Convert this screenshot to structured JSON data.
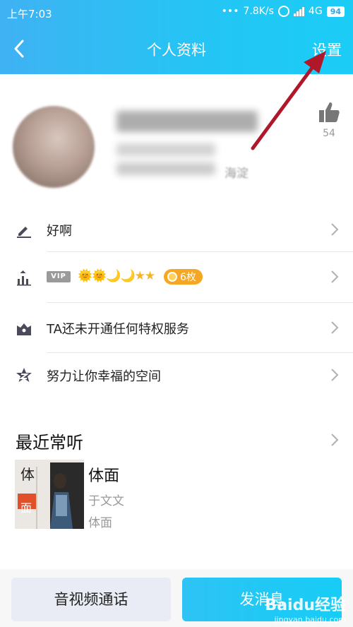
{
  "statusbar": {
    "time": "上午7:03",
    "network_speed": "7.8K/s",
    "network_type": "4G",
    "battery": "94"
  },
  "navbar": {
    "title": "个人资料",
    "settings_label": "设置"
  },
  "profile": {
    "city": "海淀",
    "like_count": "54"
  },
  "rows": [
    {
      "label": "好啊",
      "icon": "pencil-icon"
    },
    {
      "label": "VIP",
      "icon": "level-up-icon",
      "level_icons": "🌞🌞🌙🌙★★",
      "badge": "6枚"
    },
    {
      "label": "TA还未开通任何特权服务",
      "icon": "crown-icon"
    },
    {
      "label": "努力让你幸福的空间",
      "icon": "qzone-star-icon"
    }
  ],
  "recent": {
    "title": "最近常听",
    "song": {
      "title": "体面",
      "artist": "于文文",
      "album": "体面",
      "cover_text": "体面"
    }
  },
  "bottom": {
    "call_label": "音视频通话",
    "message_label": "发消息"
  },
  "watermark": {
    "brand": "Baidu经验",
    "url": "jingyan.baidu.com"
  },
  "colors": {
    "header_gradient_start": "#3fb2f3",
    "header_gradient_end": "#1bcdf6",
    "badge_orange": "#f5a623",
    "annotation_arrow": "#b0182a"
  }
}
